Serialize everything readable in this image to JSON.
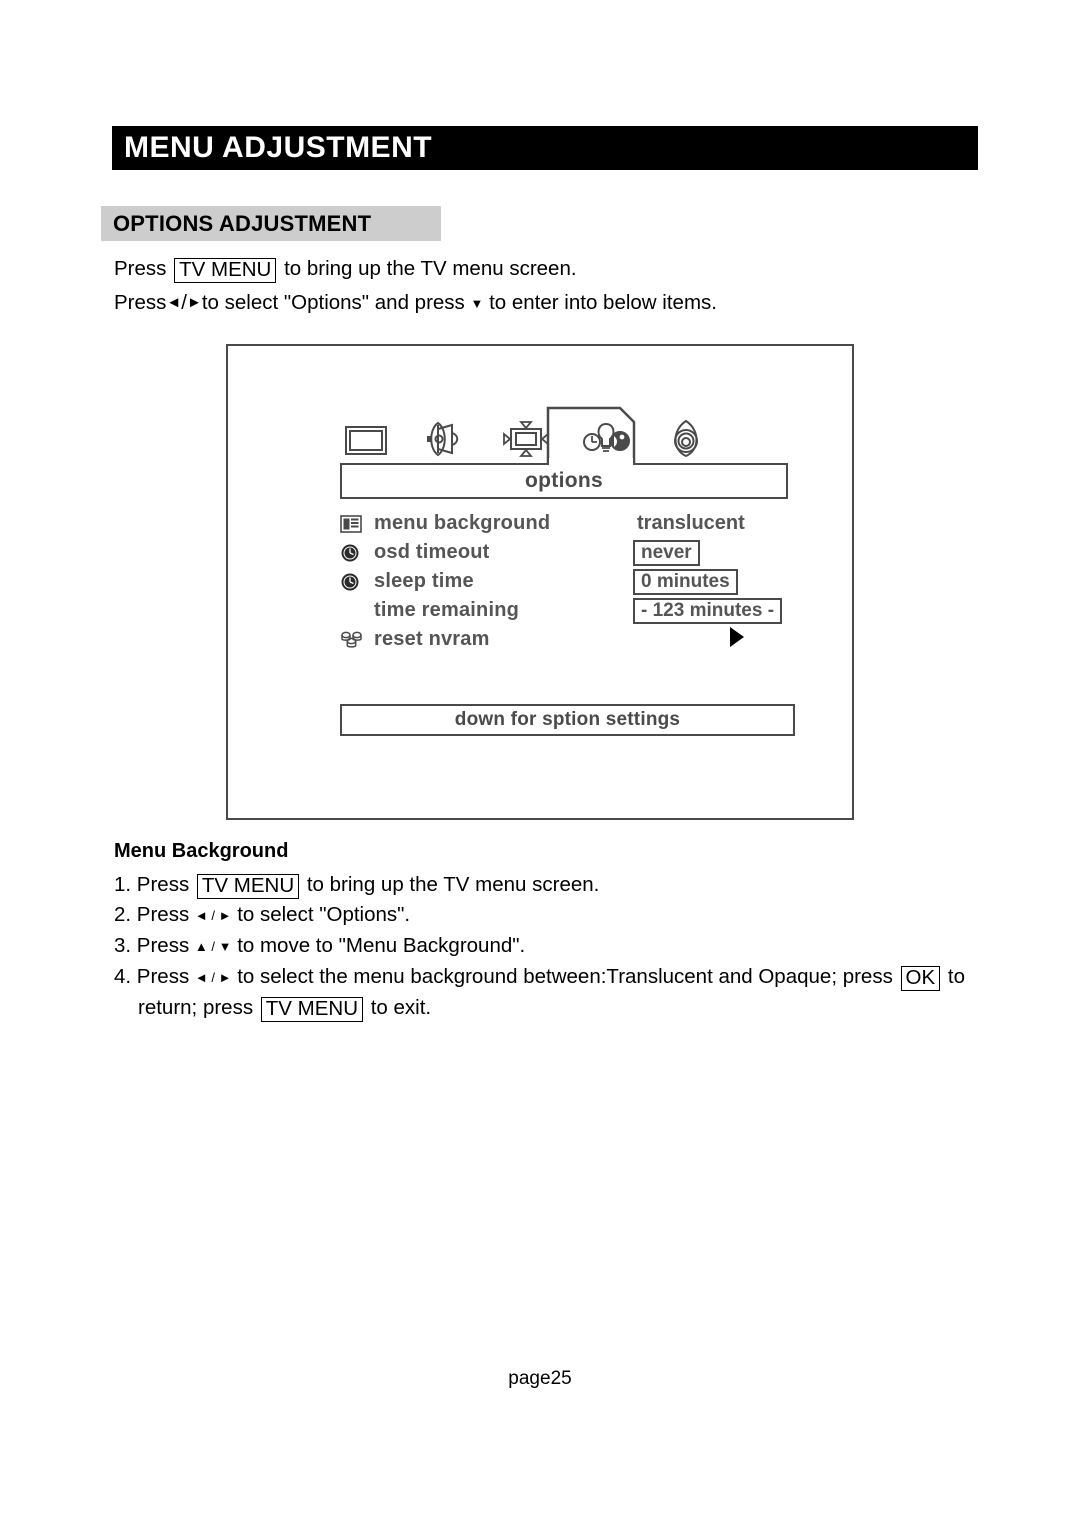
{
  "header": {
    "title": "MENU ADJUSTMENT"
  },
  "section": {
    "banner": "OPTIONS ADJUSTMENT"
  },
  "intro": {
    "line1_a": "Press",
    "line1_key": "TV MENU",
    "line1_b": "to bring up the TV menu screen.",
    "line2_a": "Press",
    "line2_left_arrow": "◄",
    "line2_slash": "/",
    "line2_right_arrow": "►",
    "line2_b": "to select \"Options\" and press",
    "line2_down_arrow": "▼",
    "line2_c": "to enter into below items."
  },
  "osd": {
    "tabs": [
      {
        "name": "picture",
        "icon": "screen-icon",
        "selected": false
      },
      {
        "name": "audio",
        "icon": "speaker-icon",
        "selected": false
      },
      {
        "name": "position",
        "icon": "position-icon",
        "selected": false
      },
      {
        "name": "options",
        "icon": "options-icon",
        "selected": true
      },
      {
        "name": "setup",
        "icon": "spiral-icon",
        "selected": false
      }
    ],
    "title": "options",
    "rows": [
      {
        "icon": "list-icon",
        "label": "menu background",
        "value": "translucent",
        "boxed": false
      },
      {
        "icon": "clock-icon",
        "label": "osd timeout",
        "value": "never",
        "boxed": true
      },
      {
        "icon": "clock-icon",
        "label": "sleep time",
        "value": "0 minutes",
        "boxed": true
      },
      {
        "icon": "none",
        "label": "time remaining",
        "value": "- 123 minutes -",
        "boxed": true
      },
      {
        "icon": "nvram-icon",
        "label": "reset nvram",
        "value": "▶",
        "boxed": false
      }
    ],
    "bottom_hint": "down for sption settings"
  },
  "instructions": {
    "subheading": "Menu Background",
    "step1": {
      "num": "1. Press",
      "key": "TV MENU",
      "tail": "to bring up the TV menu screen."
    },
    "step2": {
      "num": "2. Press",
      "arrows": "◄ / ►",
      "tail": "to select \"Options\"."
    },
    "step3": {
      "num": "3. Press",
      "arrows": "▲ / ▼",
      "tail": "to move to \"Menu Background\"."
    },
    "step4": {
      "num": "4. Press",
      "arrows": "◄ / ►",
      "mid": "to select the menu background between:Translucent and Opaque; press",
      "key_ok": "OK",
      "tail": "to",
      "line2_a": "return; press",
      "key_tvmenu": "TV MENU",
      "line2_b": "to exit."
    }
  },
  "footer": {
    "page": "page25"
  },
  "colors": {
    "header_bg": "#000000",
    "header_text": "#ffffff",
    "banner_bg": "#cdcdcd",
    "osd_line": "#4a4a4a",
    "osd_text": "#555555",
    "body_text": "#000000"
  }
}
